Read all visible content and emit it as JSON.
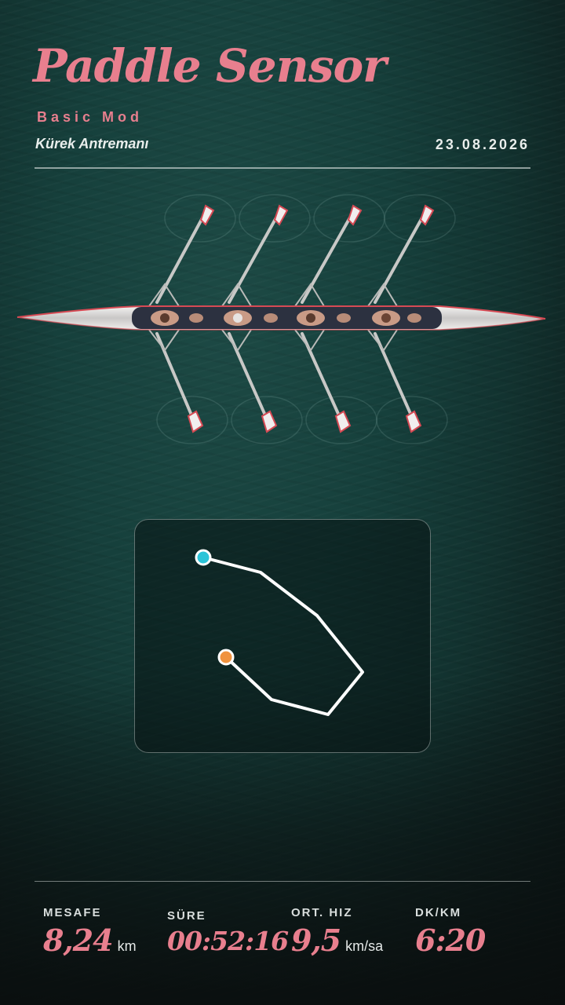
{
  "header": {
    "title": "Paddle Sensor",
    "mode": "Basic Mod",
    "activity": "Kürek Antremanı",
    "date": "23.08.2026"
  },
  "route_map": {
    "start_marker_color": "#2bc4d8",
    "end_marker_color": "#f0923e",
    "line_color": "#ffffff",
    "start_icon": "route-start-dot",
    "end_icon": "route-end-dot"
  },
  "stats": [
    {
      "label": "MESAFE",
      "value": "8,24",
      "unit": "km"
    },
    {
      "label": "SÜRE",
      "value": "00:52:16",
      "unit": ""
    },
    {
      "label": "ORT. HIZ",
      "value": "9,5",
      "unit": "km/sa"
    },
    {
      "label": "DK/KM",
      "value": "6:20",
      "unit": ""
    }
  ],
  "colors": {
    "accent": "#e87f8e",
    "text": "#e9eeec",
    "water": "#16403c"
  }
}
